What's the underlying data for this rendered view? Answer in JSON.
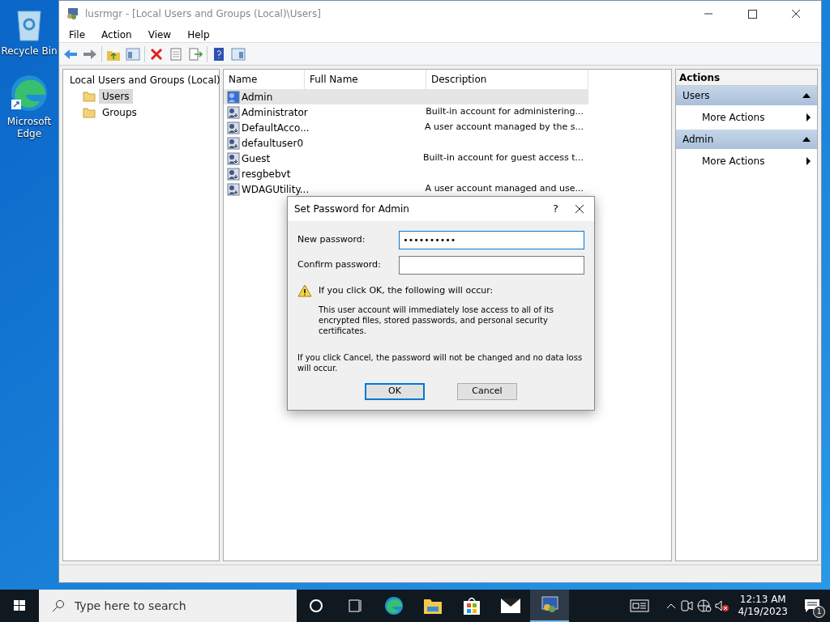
{
  "desktop_icons": [
    {
      "kind": "recycle",
      "label": "Recycle Bin"
    },
    {
      "kind": "edge",
      "label": "Microsoft Edge"
    }
  ],
  "window": {
    "title": "lusrmgr - [Local Users and Groups (Local)\\Users]",
    "menu": [
      "File",
      "Action",
      "View",
      "Help"
    ],
    "tree": {
      "label": "Local Users and Groups (Local)",
      "children": [
        {
          "label": "Users",
          "selected": true
        },
        {
          "label": "Groups",
          "selected": false
        }
      ]
    },
    "list": {
      "columns": [
        "Name",
        "Full Name",
        "Description"
      ],
      "rows": [
        {
          "name": "Admin",
          "description": null,
          "selected": true
        },
        {
          "name": "Administrator",
          "description": "Built-in account for administering...",
          "selected": false
        },
        {
          "name": "DefaultAcco...",
          "description": "A user account managed by the s...",
          "selected": false
        },
        {
          "name": "defaultuser0",
          "description": null,
          "selected": false
        },
        {
          "name": "Guest",
          "description": "Built-in account for guest access t...",
          "selected": false
        },
        {
          "name": "resgbebvt",
          "description": null,
          "selected": false
        },
        {
          "name": "WDAGUtility...",
          "description": "A user account managed and use...",
          "selected": false
        }
      ]
    },
    "actions": {
      "title": "Actions",
      "sections": [
        {
          "title": "Users",
          "expanded": true,
          "items": [
            "More Actions"
          ]
        },
        {
          "title": "Admin",
          "expanded": true,
          "items": [
            "More Actions"
          ]
        }
      ]
    }
  },
  "dialog": {
    "title": "Set Password for Admin",
    "help": "?",
    "fields": [
      {
        "label": "New password:",
        "value": "••••••••••",
        "focused": true
      },
      {
        "label": "Confirm password:",
        "focused": false
      }
    ],
    "warning_heading": "If you click OK, the following will occur:",
    "warning_body": "This user account will immediately lose access to all of its encrypted files, stored passwords, and personal security certificates.",
    "cancel_note": "If you click Cancel, the password will not be changed and no data loss will occur.",
    "buttons": [
      {
        "label": "OK",
        "default": true
      },
      {
        "label": "Cancel",
        "default": false
      }
    ]
  },
  "taskbar": {
    "search_placeholder": "Type here to search",
    "apps": [
      {
        "kind": "edge",
        "active": false
      },
      {
        "kind": "files",
        "active": false
      },
      {
        "kind": "store",
        "active": false
      },
      {
        "kind": "mail",
        "active": false
      },
      {
        "kind": "console",
        "active": true
      }
    ],
    "time": "12:13 AM",
    "date": "4/19/2023",
    "notification_count": "1"
  }
}
